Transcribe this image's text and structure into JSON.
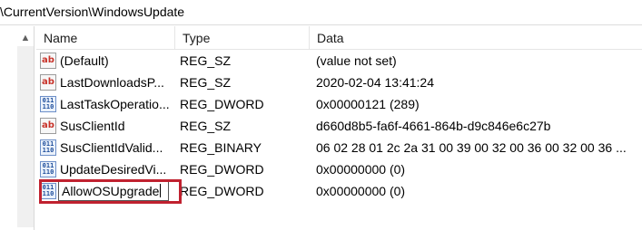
{
  "addressbar": {
    "path": "\\CurrentVersion\\WindowsUpdate"
  },
  "columns": {
    "name": "Name",
    "type": "Type",
    "data": "Data"
  },
  "icons": {
    "string_glyph": "ab",
    "binary_top": "011",
    "binary_bottom": "110"
  },
  "colors": {
    "highlight": "#c0212f",
    "string_icon": "#c8332a",
    "binary_icon": "#1f4e9b"
  },
  "rows": [
    {
      "name": "(Default)",
      "type": "REG_SZ",
      "data": "(value not set)",
      "icon": "string-value-icon"
    },
    {
      "name": "LastDownloadsP...",
      "type": "REG_SZ",
      "data": "2020-02-04 13:41:24",
      "icon": "string-value-icon"
    },
    {
      "name": "LastTaskOperatio...",
      "type": "REG_DWORD",
      "data": "0x00000121 (289)",
      "icon": "binary-value-icon"
    },
    {
      "name": "SusClientId",
      "type": "REG_SZ",
      "data": "d660d8b5-fa6f-4661-864b-d9c846e6c27b",
      "icon": "string-value-icon"
    },
    {
      "name": "SusClientIdValid...",
      "type": "REG_BINARY",
      "data": "06 02 28 01 2c 2a 31 00 39 00 32 00 36 00 32 00 36 ...",
      "icon": "binary-value-icon"
    },
    {
      "name": "UpdateDesiredVi...",
      "type": "REG_DWORD",
      "data": "0x00000000 (0)",
      "icon": "binary-value-icon"
    },
    {
      "name": "AllowOSUpgrade",
      "type": "REG_DWORD",
      "data": "0x00000000 (0)",
      "icon": "binary-value-icon",
      "editing": true
    }
  ]
}
